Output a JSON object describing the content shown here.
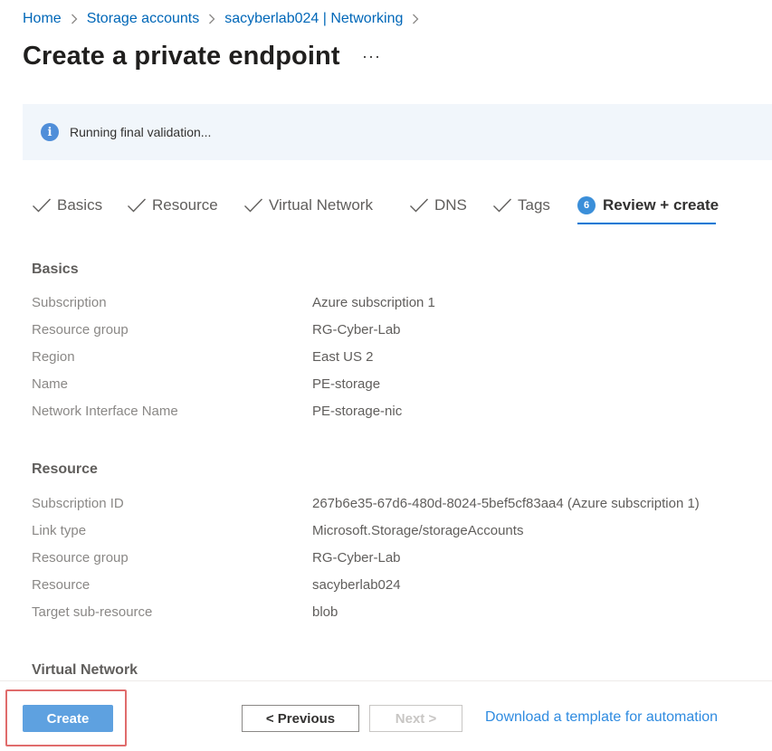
{
  "breadcrumb": {
    "items": [
      "Home",
      "Storage accounts",
      "sacyberlab024 | Networking"
    ]
  },
  "page": {
    "title": "Create a private endpoint",
    "more_label": "···"
  },
  "banner": {
    "icon": "info-icon",
    "icon_glyph": "i",
    "text": "Running final validation..."
  },
  "tabs": [
    {
      "label": "Basics",
      "state": "complete"
    },
    {
      "label": "Resource",
      "state": "complete"
    },
    {
      "label": "Virtual Network",
      "state": "complete"
    },
    {
      "label": "DNS",
      "state": "complete"
    },
    {
      "label": "Tags",
      "state": "complete"
    },
    {
      "label": "Review + create",
      "state": "active",
      "step": "6"
    }
  ],
  "sections": {
    "basics": {
      "title": "Basics",
      "rows": [
        {
          "label": "Subscription",
          "value": "Azure subscription 1"
        },
        {
          "label": "Resource group",
          "value": "RG-Cyber-Lab"
        },
        {
          "label": "Region",
          "value": "East US 2"
        },
        {
          "label": "Name",
          "value": "PE-storage"
        },
        {
          "label": "Network Interface Name",
          "value": "PE-storage-nic"
        }
      ]
    },
    "resource": {
      "title": "Resource",
      "rows": [
        {
          "label": "Subscription ID",
          "value": "267b6e35-67d6-480d-8024-5bef5cf83aa4 (Azure subscription 1)"
        },
        {
          "label": "Link type",
          "value": "Microsoft.Storage/storageAccounts"
        },
        {
          "label": "Resource group",
          "value": "RG-Cyber-Lab"
        },
        {
          "label": "Resource",
          "value": "sacyberlab024"
        },
        {
          "label": "Target sub-resource",
          "value": "blob"
        }
      ]
    },
    "virtual_network": {
      "title": "Virtual Network"
    }
  },
  "footer": {
    "create_label": "Create",
    "previous_label": "< Previous",
    "next_label": "Next >",
    "download_label": "Download a template for automation"
  },
  "colors": {
    "link": "#0067b8",
    "primary_button": "#5ea1e0",
    "highlight_border": "#e06c6c",
    "banner_bg": "#f1f6fb",
    "active_tab_underline": "#0078d4"
  }
}
